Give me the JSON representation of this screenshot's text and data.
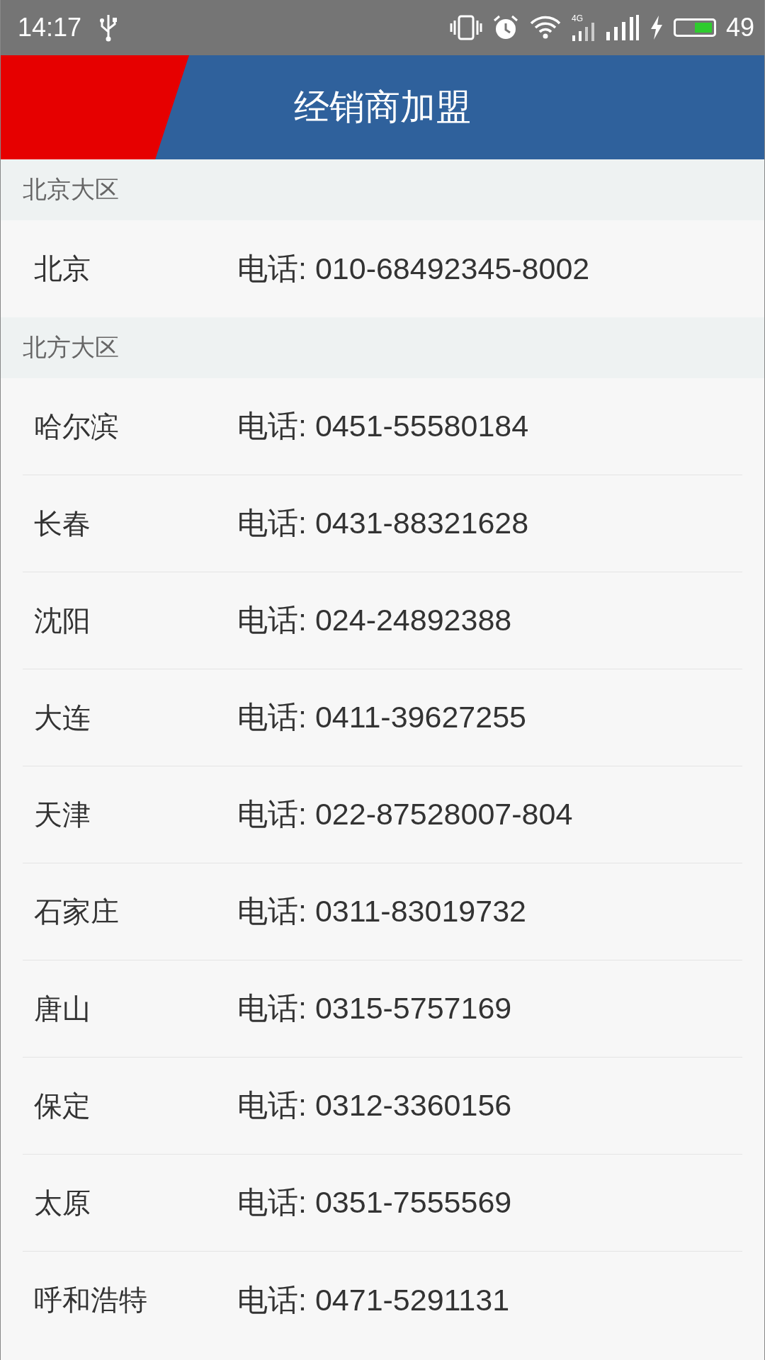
{
  "status_bar": {
    "time": "14:17",
    "network_type": "4G",
    "battery_text": "49"
  },
  "header": {
    "title": "经销商加盟"
  },
  "sections": [
    {
      "title": "北京大区",
      "rows": [
        {
          "city": "北京",
          "phone": "电话: 010-68492345-8002"
        }
      ]
    },
    {
      "title": "北方大区",
      "rows": [
        {
          "city": "哈尔滨",
          "phone": "电话: 0451-55580184"
        },
        {
          "city": "长春",
          "phone": "电话: 0431-88321628"
        },
        {
          "city": "沈阳",
          "phone": "电话: 024-24892388"
        },
        {
          "city": "大连",
          "phone": "电话: 0411-39627255"
        },
        {
          "city": "天津",
          "phone": "电话: 022-87528007-804"
        },
        {
          "city": "石家庄",
          "phone": "电话: 0311-83019732"
        },
        {
          "city": "唐山",
          "phone": "电话: 0315-5757169"
        },
        {
          "city": "保定",
          "phone": "电话: 0312-3360156"
        },
        {
          "city": "太原",
          "phone": "电话: 0351-7555569"
        },
        {
          "city": "呼和浩特",
          "phone": "电话: 0471-5291131"
        }
      ]
    }
  ]
}
